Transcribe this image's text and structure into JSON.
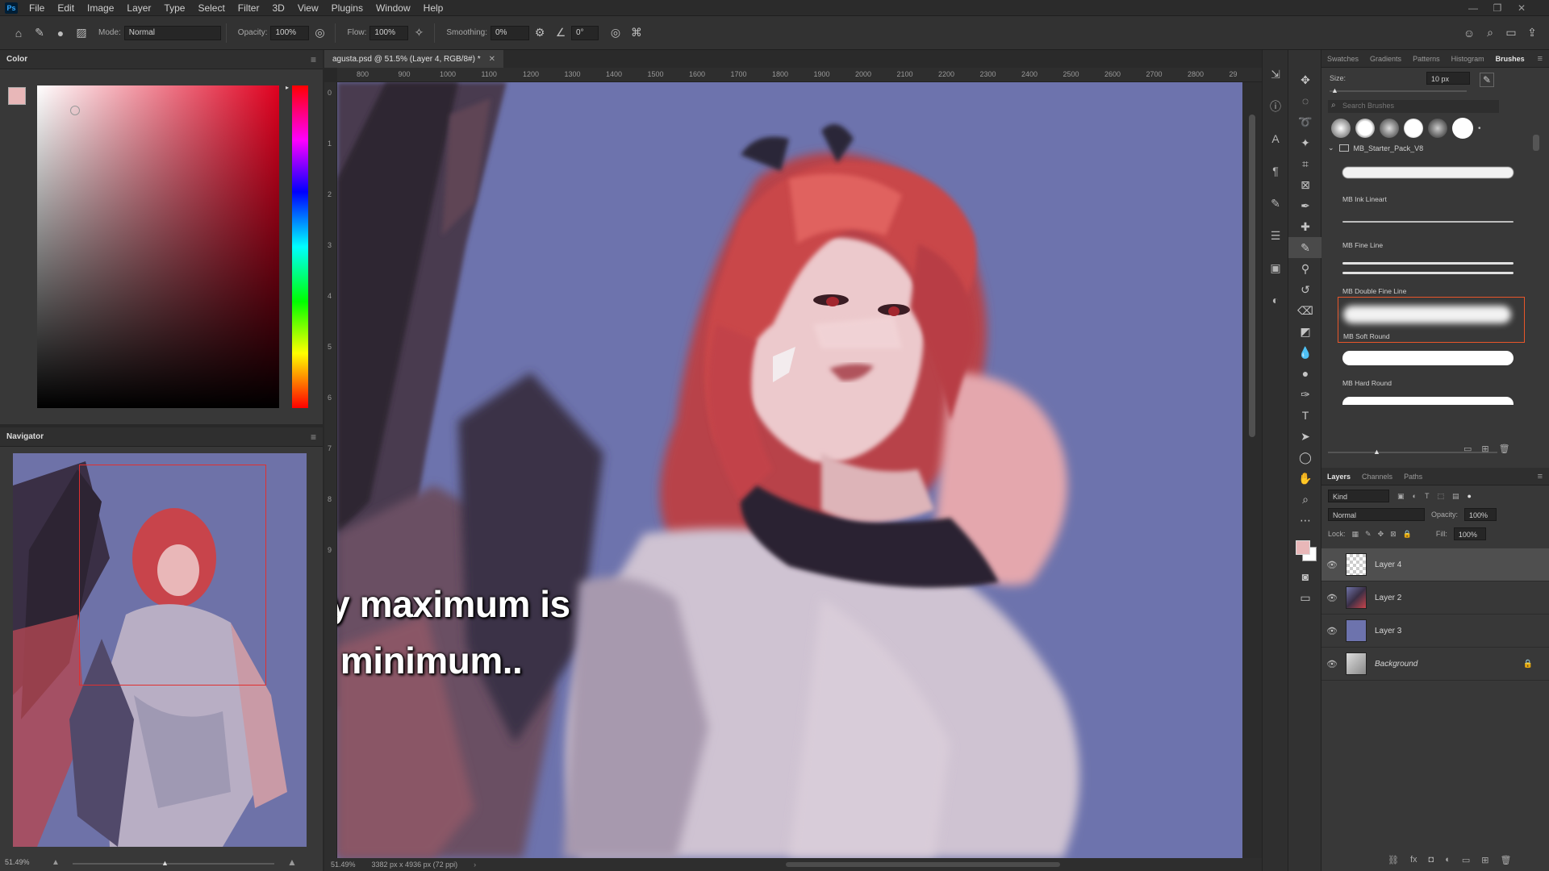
{
  "menu": [
    "File",
    "Edit",
    "Image",
    "Layer",
    "Type",
    "Select",
    "Filter",
    "3D",
    "View",
    "Plugins",
    "Window",
    "Help"
  ],
  "app_logo": "Ps",
  "options": {
    "mode_label": "Mode:",
    "mode_value": "Normal",
    "opacity_label": "Opacity:",
    "opacity_value": "100%",
    "flow_label": "Flow:",
    "flow_value": "100%",
    "smoothing_label": "Smoothing:",
    "smoothing_value": "0%",
    "angle_value": "0°"
  },
  "color_panel": {
    "title": "Color"
  },
  "navigator_panel": {
    "title": "Navigator",
    "zoom": "51.49%"
  },
  "document": {
    "tab_title": "agusta.psd @ 51.5% (Layer 4, RGB/8#) *",
    "status_zoom": "51.49%",
    "status_info": "3382 px x 4936 px (72 ppi)"
  },
  "ruler_top": [
    "800",
    "900",
    "1000",
    "1100",
    "1200",
    "1300",
    "1400",
    "1500",
    "1600",
    "1700",
    "1800",
    "1900",
    "2000",
    "2100",
    "2200",
    "2300",
    "2400",
    "2500",
    "2600",
    "2700",
    "2800",
    "29"
  ],
  "ruler_left": [
    "0",
    "1",
    "2",
    "3",
    "4",
    "5",
    "6",
    "7",
    "8",
    "9"
  ],
  "caption": {
    "line1": "me thinking my maximum is",
    "line2": "someones minimum.."
  },
  "brush_panel": {
    "tabs": [
      "Swatches",
      "Gradients",
      "Patterns",
      "Histogram",
      "Brushes"
    ],
    "active_tab": "Brushes",
    "size_label": "Size:",
    "size_value": "10 px",
    "search_placeholder": "Search Brushes",
    "folder": "MB_Starter_Pack_V8",
    "brushes": [
      {
        "name": "MB Ink Lineart"
      },
      {
        "name": "MB Fine Line"
      },
      {
        "name": "MB Double Fine Line"
      },
      {
        "name": "MB Soft Round",
        "selected": true
      },
      {
        "name": "MB Hard Round"
      }
    ]
  },
  "layers_panel": {
    "tabs": [
      "Layers",
      "Channels",
      "Paths"
    ],
    "active_tab": "Layers",
    "filter": "Kind",
    "blend_mode": "Normal",
    "opacity_label": "Opacity:",
    "opacity_value": "100%",
    "lock_label": "Lock:",
    "fill_label": "Fill:",
    "fill_value": "100%",
    "layers": [
      {
        "name": "Layer 4",
        "selected": true
      },
      {
        "name": "Layer 2"
      },
      {
        "name": "Layer 3"
      },
      {
        "name": "Background",
        "locked": true
      }
    ]
  },
  "colors": {
    "canvas_bg": "#6d73ad",
    "hair": "#c9464a",
    "accent_orange": "#e8562a",
    "foreground": "#e8b7b8"
  }
}
